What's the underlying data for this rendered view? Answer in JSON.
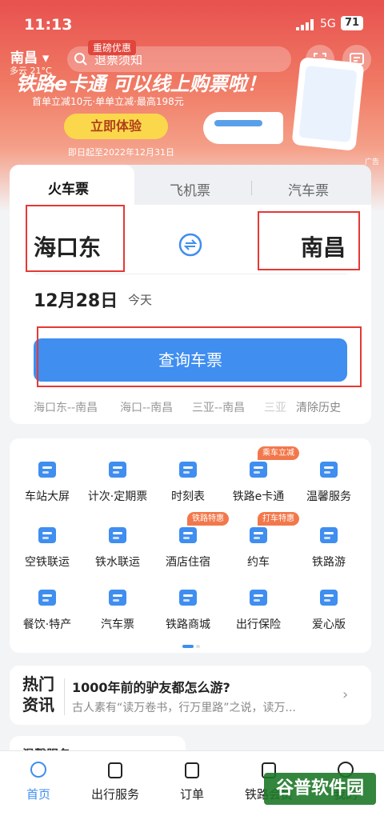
{
  "status": {
    "time": "11:13",
    "network": "5G",
    "battery": "71"
  },
  "header": {
    "city": "南昌",
    "weather": "多云 21°C",
    "search_placeholder": "退票须知",
    "ad_label": "广告"
  },
  "promo": {
    "title": "铁路e卡通 可以线上购票啦！",
    "subtitle": "首单立减10元·单单立减·最高198元",
    "cta": "立即体验",
    "date": "即日起至2022年12月31日",
    "badge": "重磅优惠"
  },
  "ticket": {
    "tabs": [
      "火车票",
      "飞机票",
      "汽车票"
    ],
    "from": "海口东",
    "to": "南昌",
    "date": "12月28日",
    "today": "今天",
    "query": "查询车票",
    "history": [
      "海口东--南昌",
      "海口--南昌",
      "三亚--南昌",
      "三亚"
    ],
    "clear": "清除历史"
  },
  "services": [
    {
      "label": "车站大屏",
      "icon": "station-screen-icon"
    },
    {
      "label": "计次·定期票",
      "icon": "ticket-pass-icon"
    },
    {
      "label": "时刻表",
      "icon": "timetable-icon"
    },
    {
      "label": "铁路e卡通",
      "icon": "ecard-icon",
      "tag": "乘车立减"
    },
    {
      "label": "温馨服务",
      "icon": "care-service-icon"
    },
    {
      "label": "空铁联运",
      "icon": "air-rail-icon"
    },
    {
      "label": "铁水联运",
      "icon": "rail-water-icon"
    },
    {
      "label": "酒店住宿",
      "icon": "hotel-icon",
      "tag": "铁路特惠"
    },
    {
      "label": "约车",
      "icon": "car-icon",
      "tag": "打车特惠"
    },
    {
      "label": "铁路游",
      "icon": "rail-tour-icon"
    },
    {
      "label": "餐饮·特产",
      "icon": "dining-icon"
    },
    {
      "label": "汽车票",
      "icon": "bus-icon"
    },
    {
      "label": "铁路商城",
      "icon": "mall-icon"
    },
    {
      "label": "出行保险",
      "icon": "insurance-icon"
    },
    {
      "label": "爱心版",
      "icon": "heart-icon"
    }
  ],
  "news": {
    "tag_line1": "热门",
    "tag_line2": "资讯",
    "title": "1000年前的驴友都怎么游?",
    "subtitle": "古人素有“读万卷书，行万里路”之说，读万..."
  },
  "peek": {
    "title": "温馨服务"
  },
  "nav": [
    {
      "label": "首页",
      "icon": "home-icon"
    },
    {
      "label": "出行服务",
      "icon": "luggage-icon"
    },
    {
      "label": "订单",
      "icon": "order-icon"
    },
    {
      "label": "铁路会员",
      "icon": "member-icon"
    },
    {
      "label": "我的",
      "icon": "profile-icon"
    }
  ],
  "watermark": "谷普软件园",
  "colors": {
    "accent": "#3f8ef0",
    "banner": "#e8514f",
    "tag": "#f2784b",
    "highlight": "#e53935"
  }
}
